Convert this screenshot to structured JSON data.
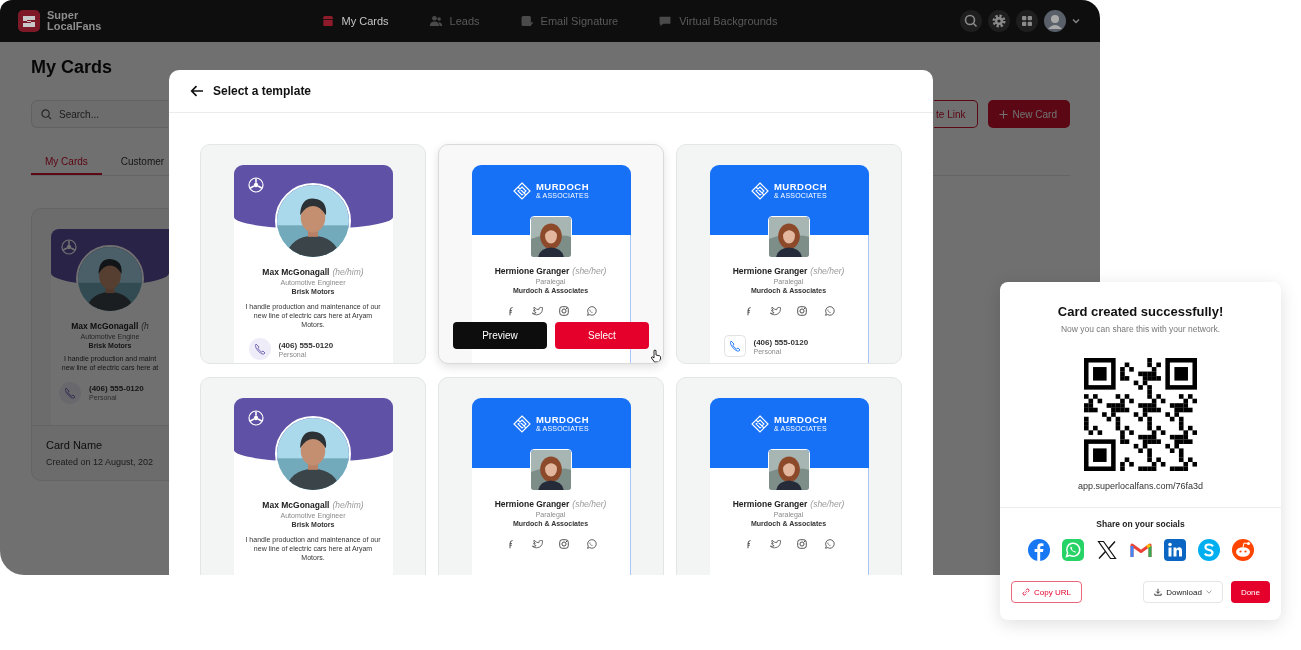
{
  "app": {
    "brand": "Super LocalFans",
    "nav": [
      {
        "label": "My Cards",
        "selected": true
      },
      {
        "label": "Leads",
        "selected": false
      },
      {
        "label": "Email Signature",
        "selected": false
      },
      {
        "label": "Virtual Backgrounds",
        "selected": false
      }
    ],
    "page_title": "My Cards",
    "search": {
      "placeholder": "Search..."
    },
    "actions": [
      {
        "label": "te Link",
        "kind": "outline"
      },
      {
        "label": "New Card",
        "kind": "primary"
      }
    ],
    "tabs": [
      {
        "label": "My Cards",
        "selected": true
      },
      {
        "label": "Customer",
        "selected": false
      }
    ],
    "card": {
      "preview": {
        "kind": "purple",
        "name": "Max McGonagall",
        "pronouns": "(h",
        "role": "Automotive Engine",
        "company": "Brisk Motors",
        "bio_lines": [
          "I handle production and maint",
          "new line of electric cars here at"
        ],
        "phone": "(406) 555-0120",
        "phone_label": "Personal"
      },
      "name": "Card Name",
      "created": "Created on 12 August, 202"
    }
  },
  "modal": {
    "title": "Select a template",
    "templates": [
      {
        "kind": "purple",
        "hovered": false,
        "name": "Max McGonagall",
        "pronouns": "(he/him)",
        "role": "Automotive Engineer",
        "company": "Brisk Motors",
        "bio": "I handle production and maintenance of our new line of electric cars here at Aryam Motors.",
        "phone": "(406) 555-0120",
        "phone_label": "Personal"
      },
      {
        "kind": "blue",
        "hovered": true,
        "brand": "MURDOCH",
        "brand_sub": "& ASSOCIATES",
        "name": "Hermione Granger",
        "pronouns": "(she/her)",
        "role": "Paralegal",
        "company": "Murdoch & Associates",
        "actions": [
          {
            "label": "Preview",
            "kind": "dark"
          },
          {
            "label": "Select",
            "kind": "primary"
          }
        ]
      },
      {
        "kind": "blue",
        "hovered": false,
        "brand": "MURDOCH",
        "brand_sub": "& ASSOCIATES",
        "name": "Hermione Granger",
        "pronouns": "(she/her)",
        "role": "Paralegal",
        "company": "Murdoch & Associates",
        "phone": "(406) 555-0120",
        "phone_label": "Personal"
      },
      {
        "kind": "purple",
        "hovered": false,
        "name": "Max McGonagall",
        "pronouns": "(he/him)",
        "role": "Automotive Engineer",
        "company": "Brisk Motors",
        "bio": "I handle production and maintenance of our new line of electric cars here at Aryam Motors."
      },
      {
        "kind": "blue",
        "hovered": false,
        "brand": "MURDOCH",
        "brand_sub": "& ASSOCIATES",
        "name": "Hermione Granger",
        "pronouns": "(she/her)",
        "role": "Paralegal",
        "company": "Murdoch & Associates"
      },
      {
        "kind": "blue",
        "hovered": false,
        "brand": "MURDOCH",
        "brand_sub": "& ASSOCIATES",
        "name": "Hermione Granger",
        "pronouns": "(she/her)",
        "role": "Paralegal",
        "company": "Murdoch & Associates"
      }
    ]
  },
  "share_popup": {
    "title": "Card created successfully!",
    "subtitle": "Now you can share this with your network.",
    "url": "app.superlocalfans.com/76fa3d",
    "share_label": "Share on your socials",
    "buttons": [
      {
        "label": "Copy URL",
        "kind": "outline"
      },
      {
        "label": "Download",
        "kind": "menu"
      },
      {
        "label": "Done",
        "kind": "primary"
      }
    ]
  }
}
